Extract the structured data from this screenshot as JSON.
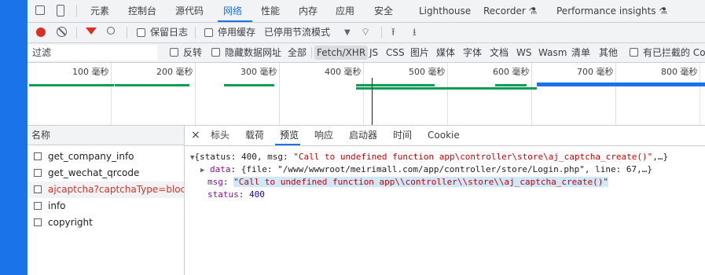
{
  "devtools": {
    "tabs": [
      "元素",
      "控制台",
      "源代码",
      "网络",
      "性能",
      "内存",
      "应用",
      "安全",
      "Lighthouse",
      "Recorder ⚗",
      "Performance insights ⚗"
    ],
    "active_tab": "网络"
  },
  "toolbar": {
    "preserve_log": "保留日志",
    "disable_cache": "停用缓存",
    "throttle": "已停用节流模式"
  },
  "filterbar": {
    "placeholder": "过滤",
    "invert": "反转",
    "hide_data_urls": "隐藏数据网址",
    "types": [
      "全部",
      "Fetch/XHR",
      "JS",
      "CSS",
      "图片",
      "媒体",
      "字体",
      "文档",
      "WS",
      "Wasm",
      "清单",
      "其他"
    ],
    "selected_type": "Fetch/XHR",
    "blocked_cookies": "有已拦截的 Co"
  },
  "timeline": {
    "ticks": [
      "100 毫秒",
      "200 毫秒",
      "300 毫秒",
      "400 毫秒",
      "500 毫秒",
      "600 毫秒",
      "700 毫秒",
      "800 毫秒"
    ]
  },
  "requests": {
    "header": "名称",
    "items": [
      {
        "name": "get_company_info",
        "status": "ok"
      },
      {
        "name": "get_wechat_qrcode",
        "status": "ok"
      },
      {
        "name": "ajcaptcha?captchaType=blockPu",
        "status": "error"
      },
      {
        "name": "info",
        "status": "ok"
      },
      {
        "name": "copyright",
        "status": "ok"
      }
    ]
  },
  "detail": {
    "close": "×",
    "tabs": [
      "标头",
      "载荷",
      "预览",
      "响应",
      "启动器",
      "时间",
      "Cookie"
    ],
    "active_tab": "预览",
    "preview": {
      "summary_open": "{status: 400, msg: ",
      "summary_msg": "\"Call to undefined function app\\controller\\store\\aj_captcha_create()\"",
      "summary_close": ",…}",
      "data_key": "data",
      "data_value": "{file: \"/www/wwwroot/meirimall.com/app/controller/store/Login.php\", line: 67,…}",
      "msg_key": "msg",
      "msg_value": "\"Call to undefined function app\\\\controller\\\\store\\\\aj_captcha_create()\"",
      "status_key": "status",
      "status_value": "400"
    }
  }
}
